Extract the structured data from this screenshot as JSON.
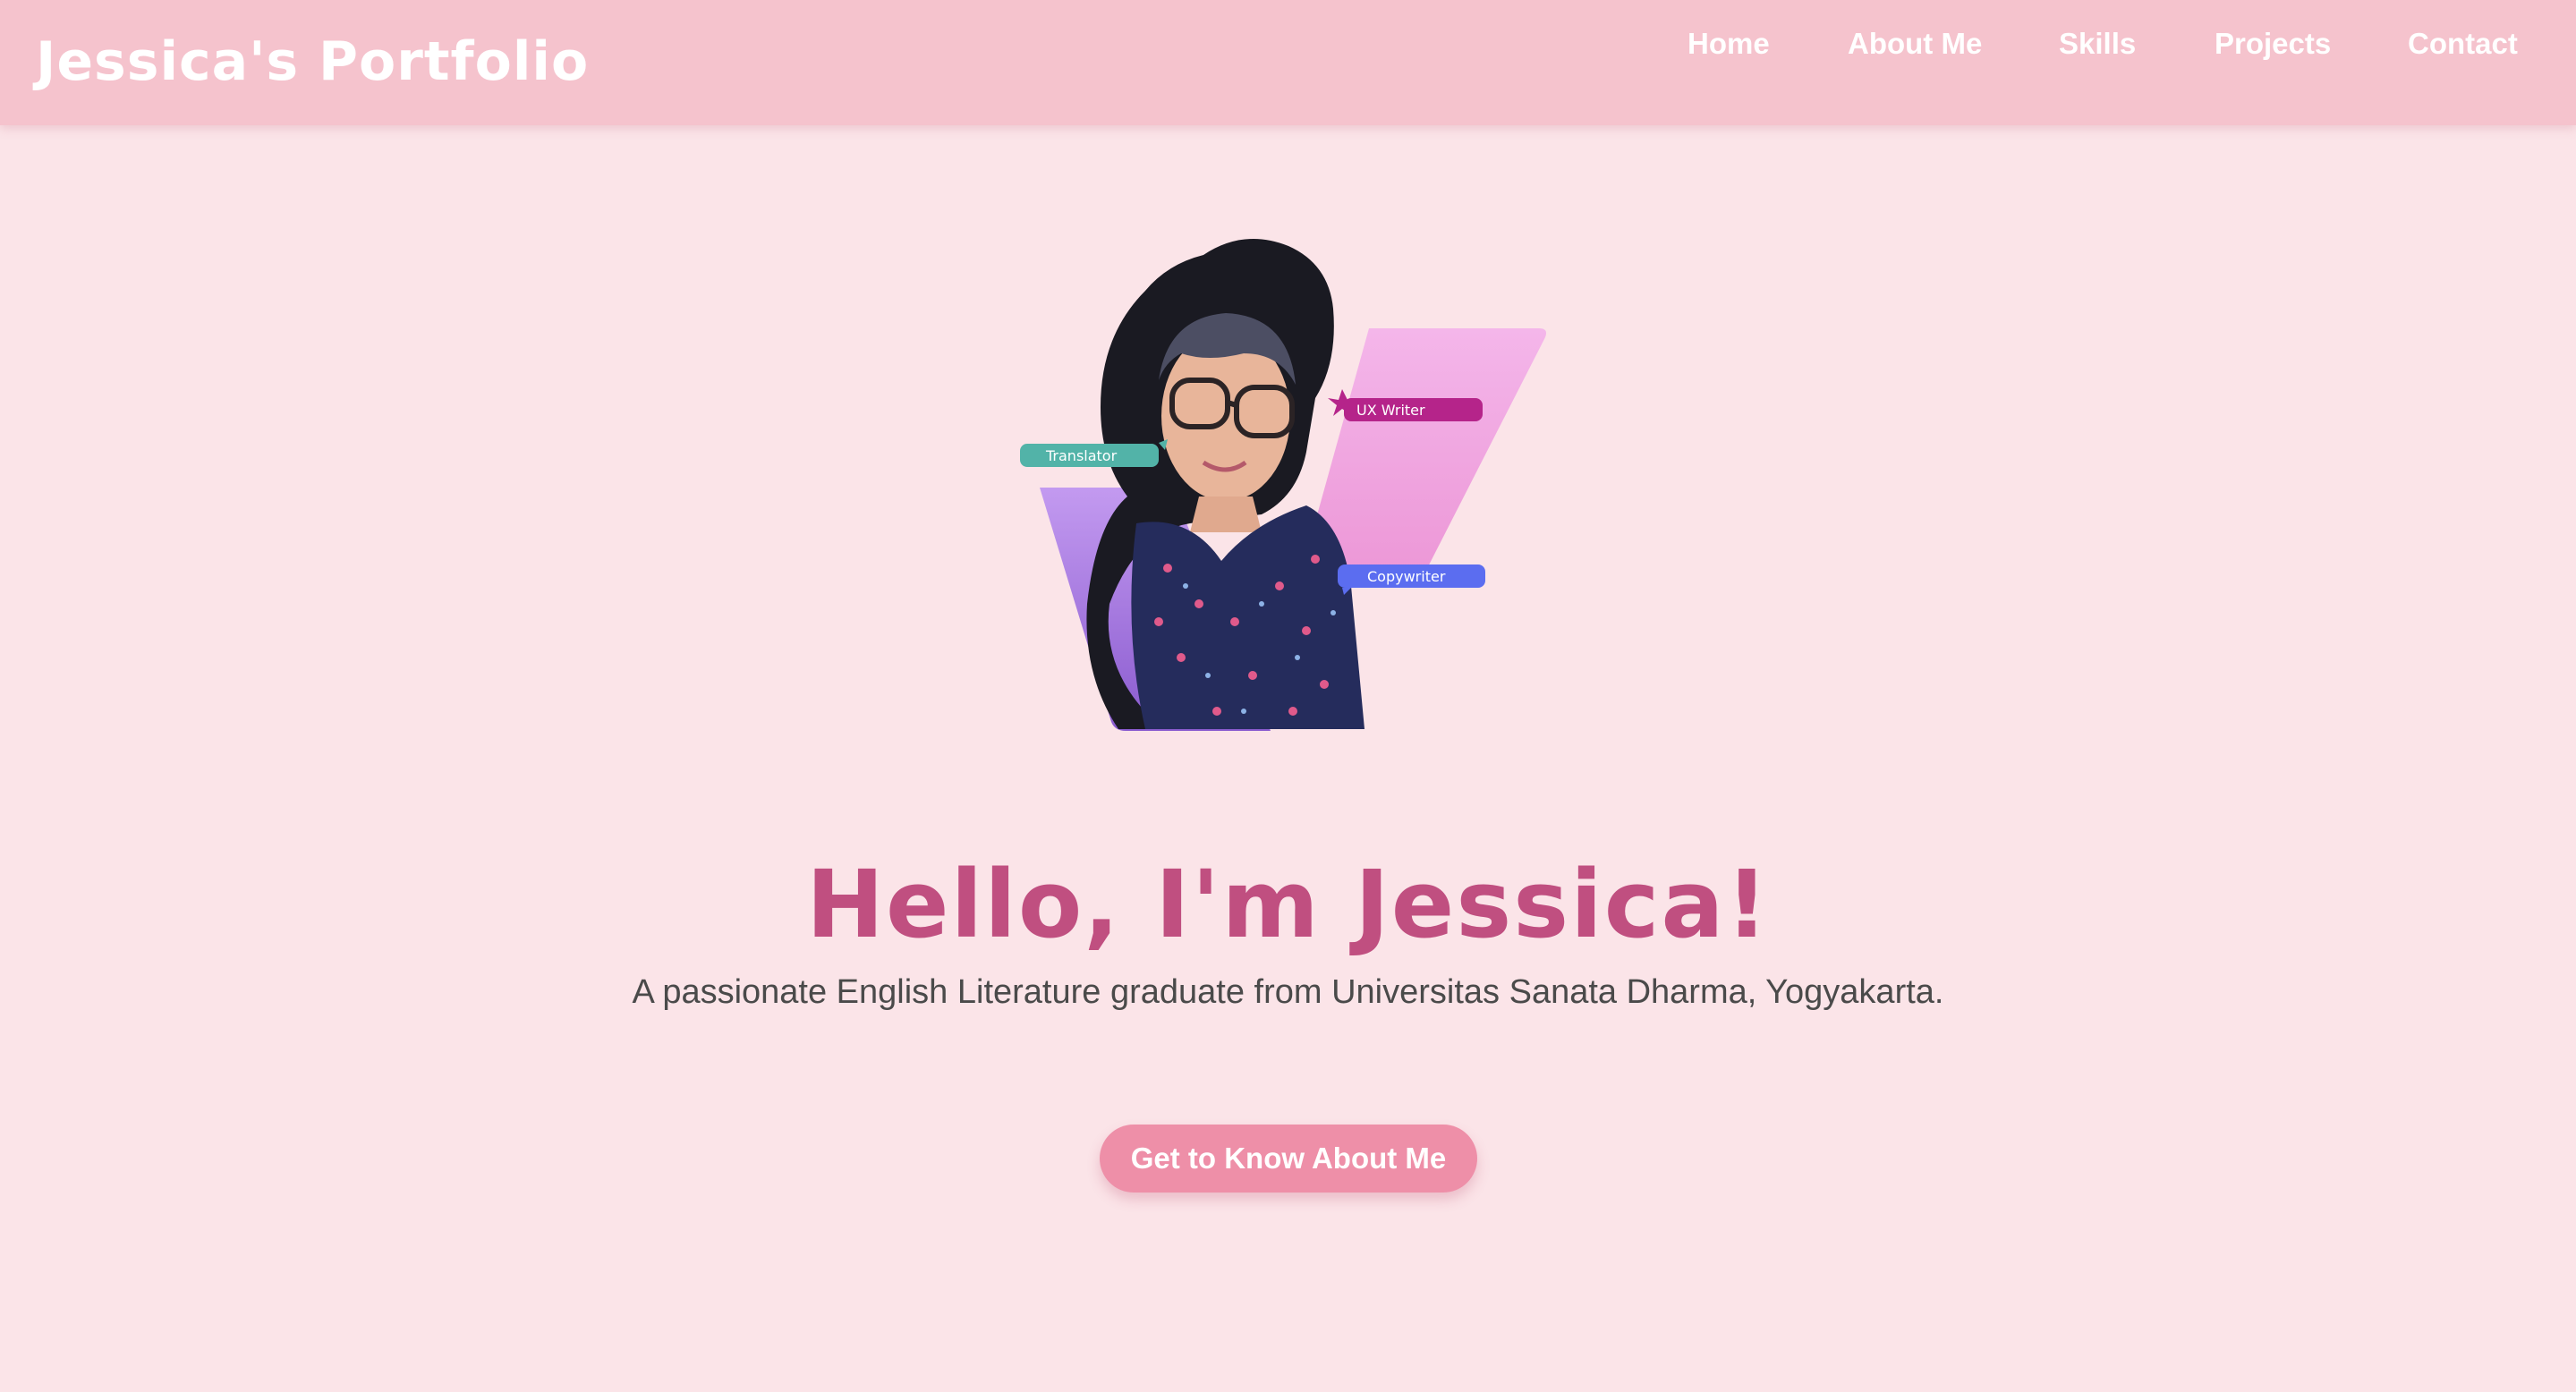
{
  "header": {
    "brand": "Jessica's Portfolio",
    "nav": [
      {
        "label": "Home"
      },
      {
        "label": "About Me"
      },
      {
        "label": "Skills"
      },
      {
        "label": "Projects"
      },
      {
        "label": "Contact"
      }
    ]
  },
  "hero": {
    "tags": {
      "ux_writer": "UX Writer",
      "translator": "Translator",
      "copywriter": "Copywriter"
    },
    "title": "Hello, I'm Jessica!",
    "subtitle": "A passionate English Literature graduate from Universitas Sanata Dharma, Yogyakarta.",
    "cta_label": "Get to Know About Me"
  },
  "colors": {
    "page_background": "#fbe4e8",
    "navbar_background": "#f5c3cd",
    "title_color": "#c04f80",
    "button_color": "#ee8fa8",
    "tag_ux_writer": "#b5248a",
    "tag_translator": "#52b3a8",
    "tag_copywriter": "#5b6df0"
  }
}
